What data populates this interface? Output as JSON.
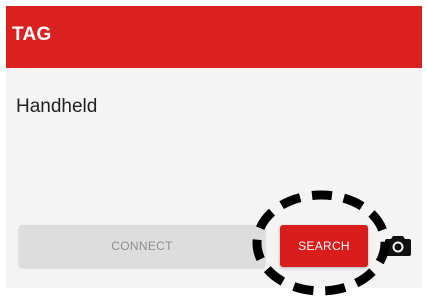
{
  "app_bar": {
    "title": "TAG",
    "color": "#db2020"
  },
  "content": {
    "device_label": "Handheld"
  },
  "actions": {
    "connect_label": "CONNECT",
    "search_label": "SEARCH",
    "camera_icon": "camera-icon",
    "accent": "#d91c1c"
  },
  "annotation": {
    "highlight_style": "dashed-black-ellipse"
  }
}
